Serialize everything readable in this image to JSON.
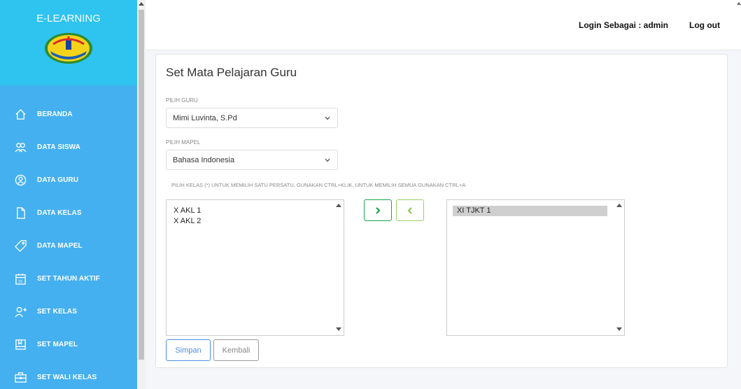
{
  "sidebar": {
    "brand": "E-LEARNING",
    "items": [
      {
        "label": "BERANDA",
        "icon": "home-icon"
      },
      {
        "label": "DATA SISWA",
        "icon": "users-icon"
      },
      {
        "label": "DATA GURU",
        "icon": "teacher-icon"
      },
      {
        "label": "DATA KELAS",
        "icon": "file-icon"
      },
      {
        "label": "DATA MAPEL",
        "icon": "tag-icon"
      },
      {
        "label": "SET TAHUN AKTIF",
        "icon": "calendar-icon"
      },
      {
        "label": "SET KELAS",
        "icon": "add-user-icon"
      },
      {
        "label": "SET MAPEL",
        "icon": "book-icon"
      },
      {
        "label": "SET WALI KELAS",
        "icon": "briefcase-icon"
      }
    ]
  },
  "topbar": {
    "login_as": "Login Sebagai : admin",
    "logout": "Log out"
  },
  "form": {
    "title": "Set Mata Pelajaran Guru",
    "guru_label": "PILIH GURU",
    "guru_value": "Mimi Luvinta, S.Pd",
    "mapel_label": "PILIH MAPEL",
    "mapel_value": "Bahasa Indonesia",
    "kelas_hint": "PILIH KELAS (*) UNTUK MEMILIH SATU PERSATU, GUNAKAN CTRL+KLIK, UNTUK MEMILIH SEMUA GUNAKAN CTRL+A",
    "available": [
      "X AKL 1",
      "X AKL 2"
    ],
    "selected": [
      "XI TJKT 1"
    ],
    "save_label": "Simpan",
    "back_label": "Kembali"
  },
  "colors": {
    "sidebar": "#45b0f0",
    "sidebar_header": "#2fc3f0",
    "move_right_border": "#1aa44a",
    "move_left_border": "#9ad06a",
    "save_button": "#4a8ee6"
  }
}
